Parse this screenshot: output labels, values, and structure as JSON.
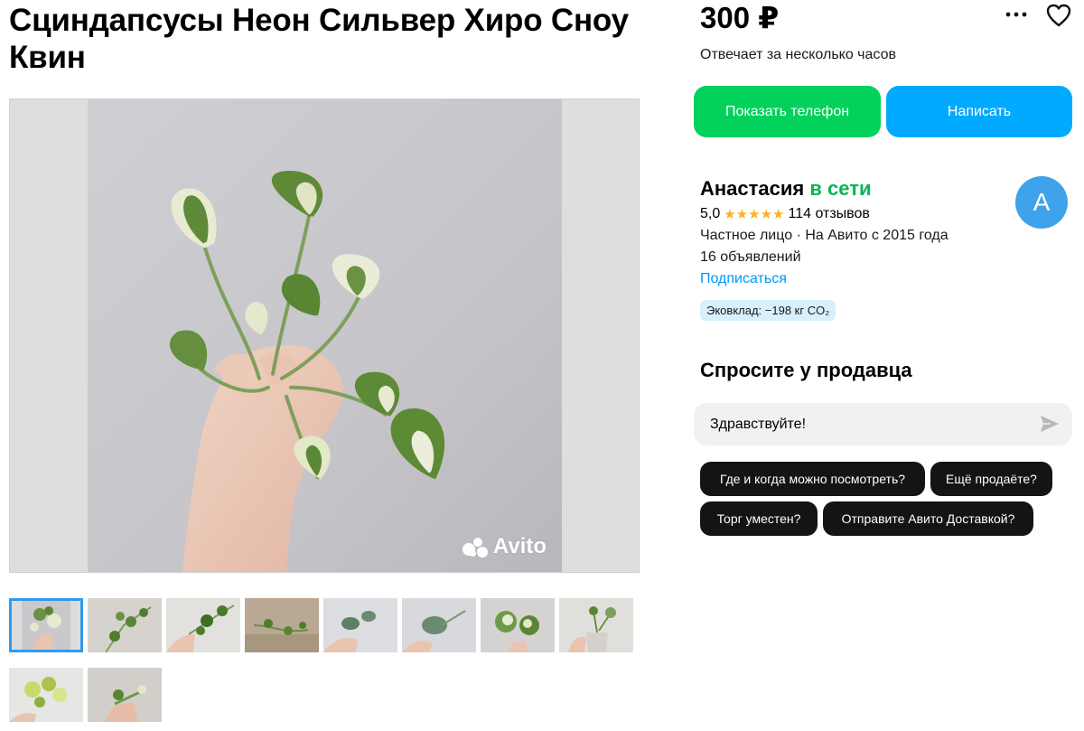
{
  "listing": {
    "title": "Сциндапсусы Неон Сильвер Хиро Сноу Квин",
    "price": "300 ₽",
    "responds": "Отвечает за несколько часов",
    "watermark": "Avito"
  },
  "actions": {
    "show_phone": "Показать телефон",
    "write": "Написать"
  },
  "seller": {
    "name": "Анастасия",
    "status": "в сети",
    "avatar_letter": "А",
    "rating": "5,0",
    "stars": "★★★★★",
    "reviews": "114 отзывов",
    "type": "Частное лицо · На Авито с 2015 года",
    "listings": "16 объявлений",
    "subscribe": "Подписаться",
    "eco": "Эковклад: −198 кг CO₂"
  },
  "ask": {
    "title": "Спросите у продавца",
    "message_value": "Здравствуйте!",
    "quick_replies": [
      "Где и когда можно посмотреть?",
      "Ещё продаёте?",
      "Торг уместен?",
      "Отправите Авито Доставкой?"
    ]
  },
  "colors": {
    "phone_button": "#02d15c",
    "write_button": "#00aaff",
    "online": "#02b653",
    "link": "#0099f7",
    "star": "#ffb021",
    "avatar": "#3ea3ea",
    "thumb_active": "#2f9bf0"
  },
  "icons": {
    "more": "more-dots-icon",
    "favorite": "heart-icon",
    "send": "send-icon"
  }
}
